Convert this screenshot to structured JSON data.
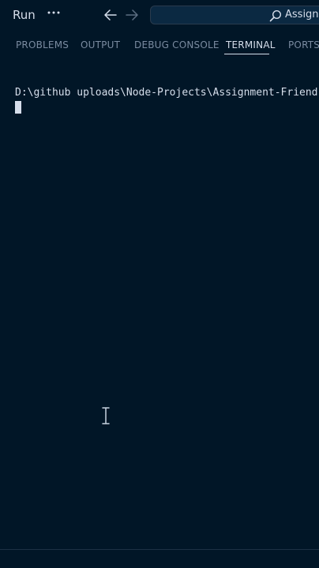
{
  "menu": {
    "run_label": "Run"
  },
  "icons": {
    "more": "ellipsis-icon",
    "back": "arrow-left-icon",
    "forward": "arrow-right-icon",
    "search": "search-icon",
    "cursor": "i-beam-icon"
  },
  "command_center": {
    "label": "Assignm"
  },
  "panel": {
    "tabs": [
      {
        "label": "PROBLEMS",
        "active": false
      },
      {
        "label": "OUTPUT",
        "active": false
      },
      {
        "label": "DEBUG CONSOLE",
        "active": false
      },
      {
        "label": "TERMINAL",
        "active": true
      },
      {
        "label": "PORTS",
        "active": false
      }
    ]
  },
  "terminal": {
    "prompt": "D:\\github uploads\\Node-Projects\\Assignment-Friend-"
  },
  "colors": {
    "background": "#011627",
    "foreground": "#d6deeb",
    "inactive_tab": "#7a8ba0"
  }
}
